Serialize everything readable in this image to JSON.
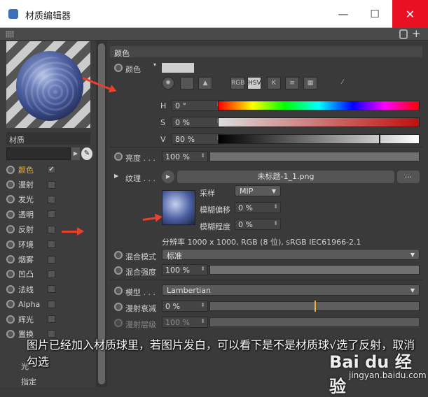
{
  "window": {
    "title": "材质编辑器",
    "min": "—",
    "max": "☐",
    "close": "✕"
  },
  "left": {
    "material_label": "材质",
    "channels": [
      {
        "label": "颜色",
        "checked": "✓",
        "active": true
      },
      {
        "label": "漫射",
        "checked": ""
      },
      {
        "label": "发光",
        "checked": ""
      },
      {
        "label": "透明",
        "checked": ""
      },
      {
        "label": "反射",
        "checked": ""
      },
      {
        "label": "环境",
        "checked": ""
      },
      {
        "label": "烟雾",
        "checked": ""
      },
      {
        "label": "凹凸",
        "checked": ""
      },
      {
        "label": "法线",
        "checked": ""
      },
      {
        "label": "Alpha",
        "checked": ""
      },
      {
        "label": "辉光",
        "checked": ""
      },
      {
        "label": "置换",
        "checked": ""
      }
    ],
    "bottom_items": [
      "光",
      "指定"
    ]
  },
  "color": {
    "section": "颜色",
    "color_label": "颜色",
    "modes": [
      "RGB",
      "HSV",
      "K"
    ],
    "active_mode": "HSV",
    "h_label": "H",
    "h_value": "0 °",
    "s_label": "S",
    "s_value": "0 %",
    "v_label": "V",
    "v_value": "80 %",
    "v_level": 0.8,
    "brightness_label": "亮度 . . .",
    "brightness_value": "100 %",
    "texture_label": "纹理 . . .",
    "texture_file": "未标题-1_1.png",
    "texture_btn": "...",
    "sampling_label": "采样",
    "sampling_value": "MIP",
    "blur_offset_label": "模糊偏移",
    "blur_offset_value": "0 %",
    "blur_scale_label": "模糊程度",
    "blur_scale_value": "0 %",
    "resolution_info": "分辨率 1000 x 1000, RGB (8 位), sRGB IEC61966-2.1",
    "mix_mode_label": "混合模式",
    "mix_mode_value": "标准",
    "mix_strength_label": "混合强度",
    "mix_strength_value": "100 %",
    "model_label": "模型 . . .",
    "model_value": "Lambertian",
    "diffuse_falloff_label": "漫射衰减",
    "diffuse_falloff_value": "0 %",
    "diffuse_falloff_level": 0.5,
    "diffuse_level_label": "漫射层级",
    "diffuse_level_value": "100 %"
  },
  "caption": "图片已经加入材质球里，若图片发白，可以看下是不是材质球√选了反射，取消勾选",
  "watermark": "Bai du 经验",
  "watermark_url": "jingyan.baidu.com",
  "colors": {
    "accent": "#f2b030",
    "close": "#e81123",
    "arrow": "#e8402a"
  }
}
